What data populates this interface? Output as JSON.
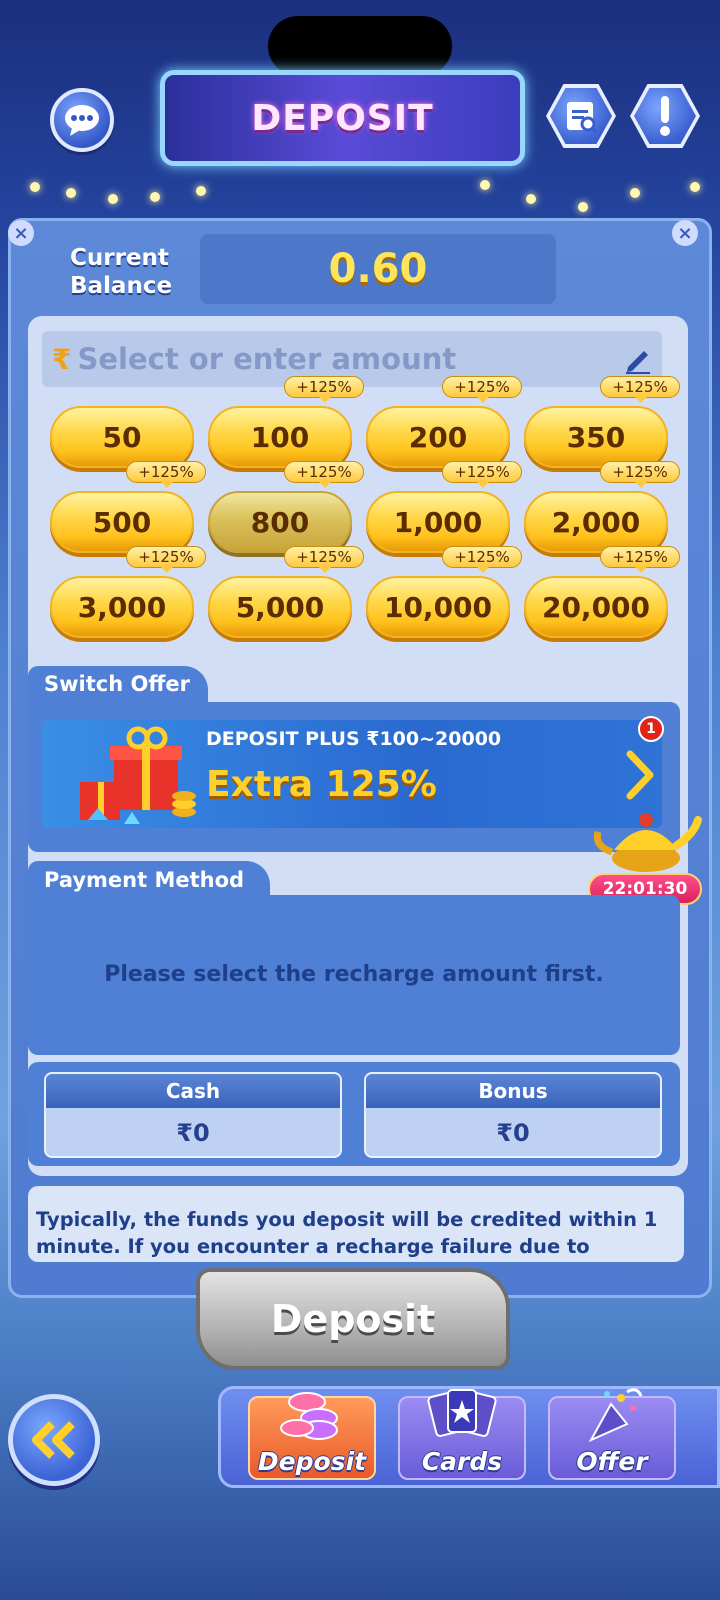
{
  "header": {
    "title": "DEPOSIT",
    "support_icon": "chat-support-icon",
    "records_icon": "records-icon",
    "info_icon": "exclamation-icon"
  },
  "balance": {
    "label": "Current Balance",
    "label_line1": "Current",
    "label_line2": "Balance",
    "value": "0.60"
  },
  "amount": {
    "currency_symbol": "₹",
    "placeholder": "Select or enter amount",
    "options": [
      {
        "value": "50",
        "bonus": ""
      },
      {
        "value": "100",
        "bonus": "+125%"
      },
      {
        "value": "200",
        "bonus": "+125%"
      },
      {
        "value": "350",
        "bonus": "+125%"
      },
      {
        "value": "500",
        "bonus": "+125%"
      },
      {
        "value": "800",
        "bonus": "+125%"
      },
      {
        "value": "1,000",
        "bonus": "+125%"
      },
      {
        "value": "2,000",
        "bonus": "+125%"
      },
      {
        "value": "3,000",
        "bonus": "+125%"
      },
      {
        "value": "5,000",
        "bonus": "+125%"
      },
      {
        "value": "10,000",
        "bonus": "+125%"
      },
      {
        "value": "20,000",
        "bonus": "+125%"
      }
    ]
  },
  "offer": {
    "section_label": "Switch Offer",
    "title": "DEPOSIT PLUS  ₹100~20000",
    "extra": "Extra 125%",
    "badge_count": "1",
    "timer": "22:01:30"
  },
  "payment": {
    "section_label": "Payment Method",
    "message": "Please select the recharge amount first."
  },
  "wallet": {
    "cash_label": "Cash",
    "cash_value": "₹0",
    "bonus_label": "Bonus",
    "bonus_value": "₹0"
  },
  "info": {
    "text": "Typically, the funds you deposit will be credited within 1 minute. If you encounter a recharge failure due to channel fluctuations, we"
  },
  "deposit_button": {
    "label": "Deposit"
  },
  "nav": {
    "items": [
      {
        "label": "Deposit",
        "icon": "chips-icon",
        "active": true
      },
      {
        "label": "Cards",
        "icon": "cards-icon",
        "active": false
      },
      {
        "label": "Offer",
        "icon": "party-popper-icon",
        "active": false
      }
    ]
  },
  "colors": {
    "gold": "#ffc21d",
    "bonus_text": "#ffcf2a",
    "panel": "#d2def6",
    "accent_blue": "#4f80d6",
    "badge_red": "#e2231a"
  }
}
